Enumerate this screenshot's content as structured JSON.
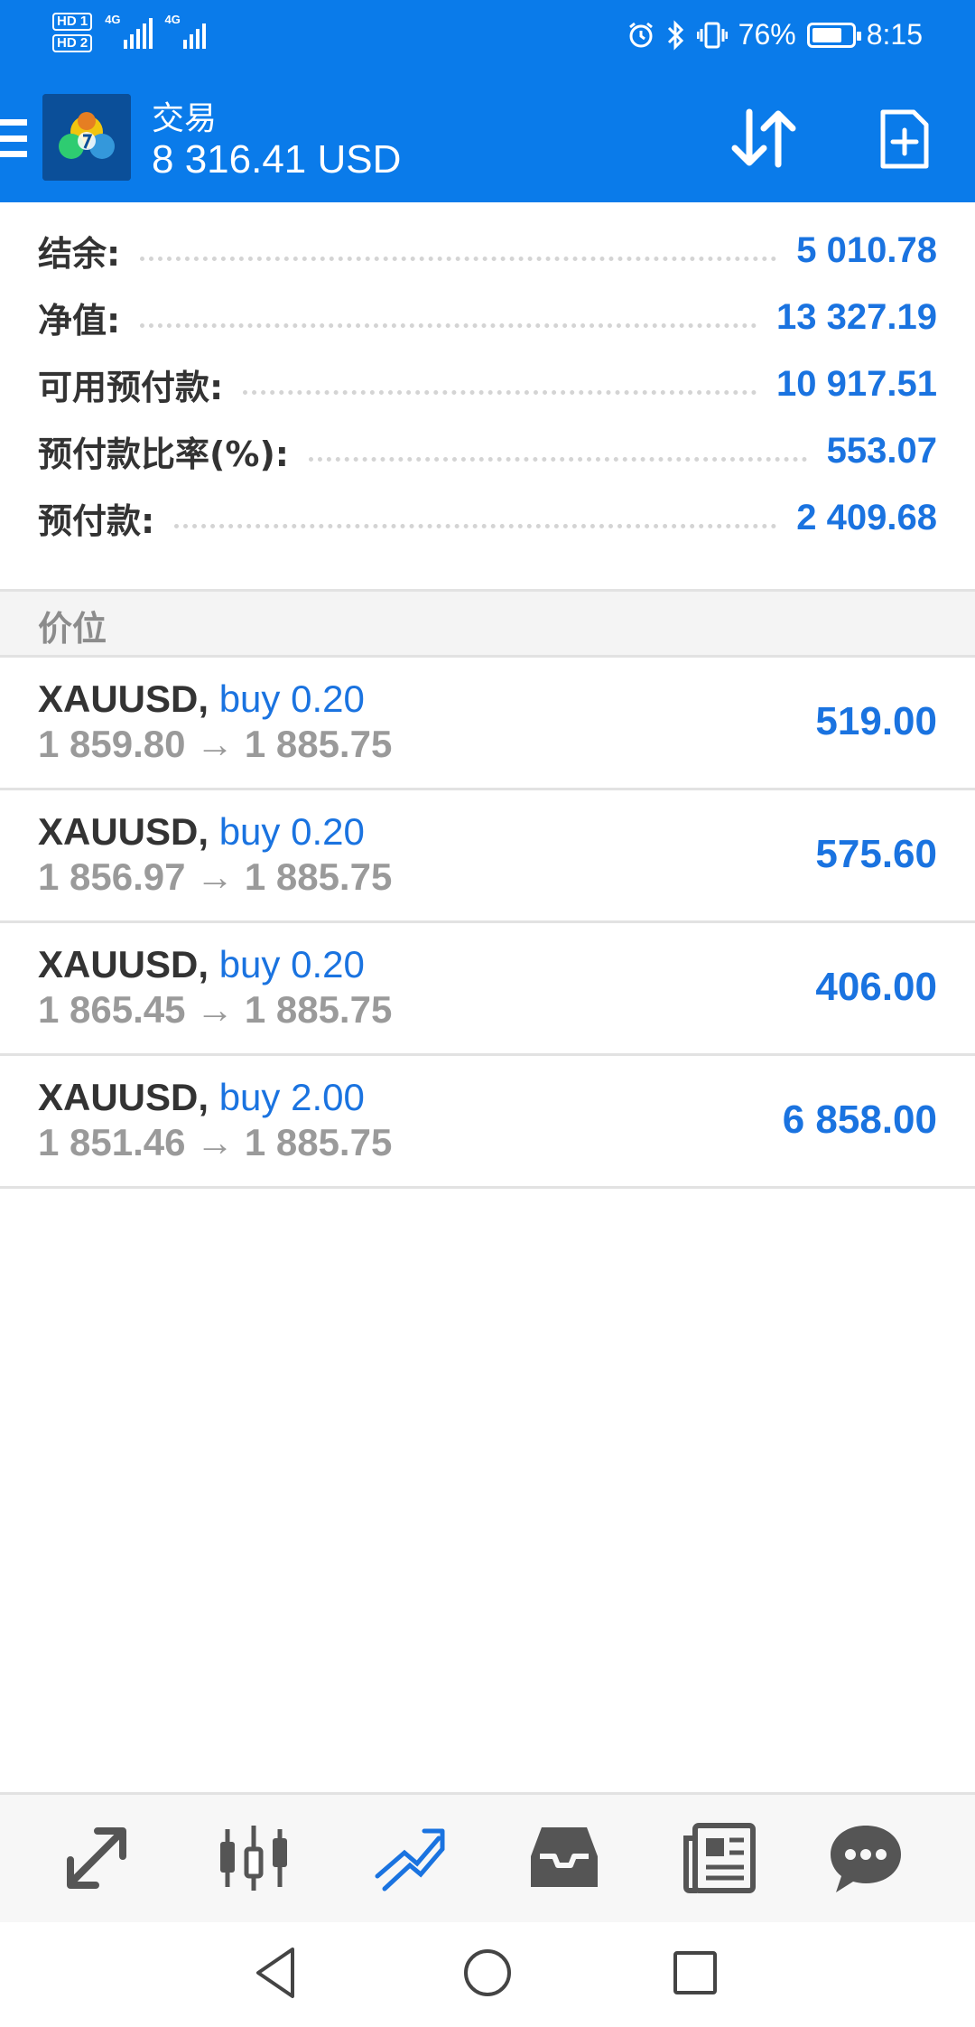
{
  "status_bar": {
    "hd1": "HD 1",
    "hd2": "HD 2",
    "sim1_network": "4G",
    "sim2_network": "4G",
    "battery_percent": "76%",
    "battery_level": 0.76,
    "time": "8:15",
    "icons": [
      "alarm-icon",
      "bluetooth-icon",
      "vibrate-icon",
      "battery-icon"
    ]
  },
  "header": {
    "title": "交易",
    "balance": "8 316.41 USD"
  },
  "summary": [
    {
      "label": "结余:",
      "value": "5 010.78"
    },
    {
      "label": "净值:",
      "value": "13 327.19"
    },
    {
      "label": "可用预付款:",
      "value": "10 917.51"
    },
    {
      "label": "预付款比率(%):",
      "value": "553.07"
    },
    {
      "label": "预付款:",
      "value": "2 409.68"
    }
  ],
  "section_title": "价位",
  "positions": [
    {
      "symbol": "XAUUSD,",
      "side": "buy 0.20",
      "price_line": "1 859.80 → 1 885.75",
      "profit": "519.00"
    },
    {
      "symbol": "XAUUSD,",
      "side": "buy 0.20",
      "price_line": "1 856.97 → 1 885.75",
      "profit": "575.60"
    },
    {
      "symbol": "XAUUSD,",
      "side": "buy 0.20",
      "price_line": "1 865.45 → 1 885.75",
      "profit": "406.00"
    },
    {
      "symbol": "XAUUSD,",
      "side": "buy 2.00",
      "price_line": "1 851.46 → 1 885.75",
      "profit": "6 858.00"
    }
  ],
  "bottom_nav": {
    "items": [
      "quotes-icon",
      "chart-icon",
      "trade-icon",
      "history-icon",
      "news-icon",
      "chat-icon"
    ],
    "active": "trade-icon"
  },
  "colors": {
    "header_blue": "#0a7bea",
    "value_blue": "#1a73e0",
    "muted_gray": "#9a9a9a"
  }
}
